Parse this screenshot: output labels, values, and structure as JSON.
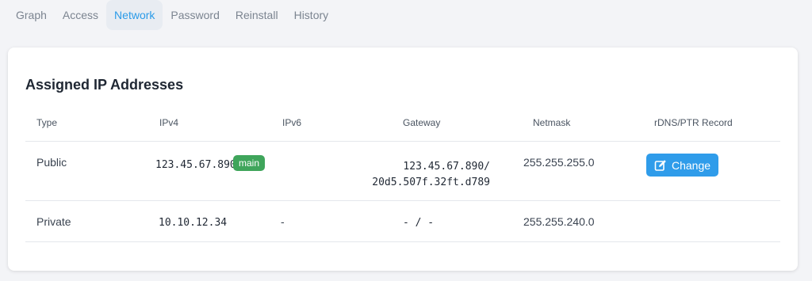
{
  "tabs": [
    {
      "label": "Graph",
      "active": false
    },
    {
      "label": "Access",
      "active": false
    },
    {
      "label": "Network",
      "active": true
    },
    {
      "label": "Password",
      "active": false
    },
    {
      "label": "Reinstall",
      "active": false
    },
    {
      "label": "History",
      "active": false
    }
  ],
  "card": {
    "title": "Assigned IP Addresses",
    "headers": {
      "type": "Type",
      "ipv4": "IPv4",
      "ipv6": "IPv6",
      "gateway": "Gateway",
      "netmask": "Netmask",
      "rdns": "rDNS/PTR Record"
    },
    "rows": [
      {
        "type": "Public",
        "ipv4": "123.45.67.890",
        "badge": "main",
        "ipv6": "",
        "gateway_line1": "123.45.67.890/",
        "gateway_line2": "20d5.507f.32ft.d789",
        "netmask": "255.255.255.0",
        "action": "Change"
      },
      {
        "type": "Private",
        "ipv4": "10.10.12.34",
        "ipv6": "-",
        "gateway": "- / -",
        "netmask": "255.255.240.0"
      }
    ]
  },
  "colors": {
    "accent": "#2f9cea",
    "badge": "#3fa55b",
    "active_tab_bg": "#e8ecf2"
  },
  "icons": {
    "change_button": "edit-icon"
  }
}
